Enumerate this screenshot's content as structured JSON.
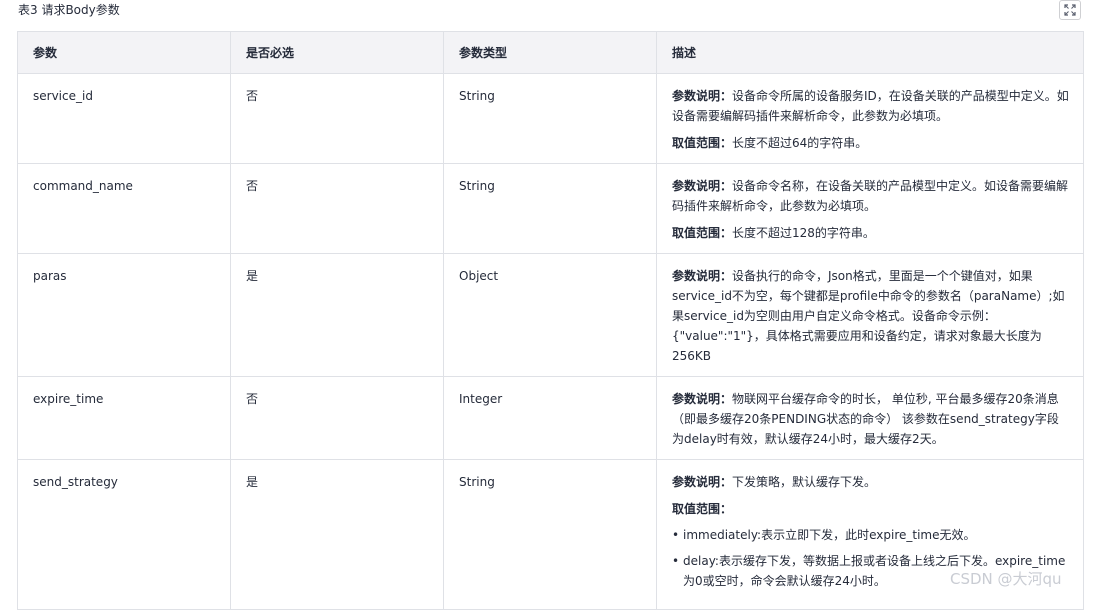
{
  "caption": "表3 请求Body参数",
  "columns": [
    "参数",
    "是否必选",
    "参数类型",
    "描述"
  ],
  "rows": [
    {
      "param": "service_id",
      "required": "否",
      "type": "String",
      "desc_label": "参数说明：",
      "desc_text": "设备命令所属的设备服务ID，在设备关联的产品模型中定义。如设备需要编解码插件来解析命令，此参数为必填项。",
      "range_label": "取值范围：",
      "range_text": "长度不超过64的字符串。"
    },
    {
      "param": "command_name",
      "required": "否",
      "type": "String",
      "desc_label": "参数说明：",
      "desc_text": "设备命令名称，在设备关联的产品模型中定义。如设备需要编解码插件来解析命令，此参数为必填项。",
      "range_label": "取值范围：",
      "range_text": "长度不超过128的字符串。"
    },
    {
      "param": "paras",
      "required": "是",
      "type": "Object",
      "desc_label": "参数说明：",
      "desc_text": "设备执行的命令，Json格式，里面是一个个键值对，如果service_id不为空，每个键都是profile中命令的参数名（paraName）;如果service_id为空则由用户自定义命令格式。设备命令示例：{\"value\":\"1\"}，具体格式需要应用和设备约定，请求对象最大长度为256KB"
    },
    {
      "param": "expire_time",
      "required": "否",
      "type": "Integer",
      "desc_label": "参数说明：",
      "desc_text": "物联网平台缓存命令的时长， 单位秒, 平台最多缓存20条消息（即最多缓存20条PENDING状态的命令） 该参数在send_strategy字段为delay时有效，默认缓存24小时，最大缓存2天。"
    },
    {
      "param": "send_strategy",
      "required": "是",
      "type": "String",
      "desc_label": "参数说明：",
      "desc_text": "下发策略，默认缓存下发。",
      "range_label": "取值范围：",
      "range_items": [
        "immediately:表示立即下发，此时expire_time无效。",
        "delay:表示缓存下发，等数据上报或者设备上线之后下发。expire_time为0或空时，命令会默认缓存24小时。"
      ]
    }
  ],
  "watermark": "CSDN @大河qu"
}
